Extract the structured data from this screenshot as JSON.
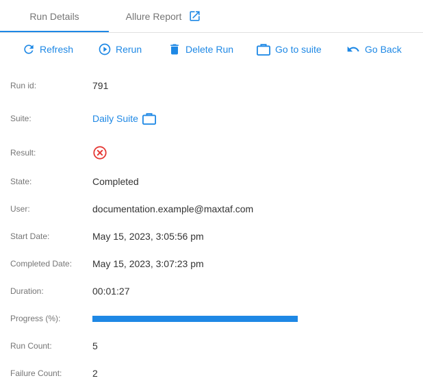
{
  "colors": {
    "accent": "#1e88e5",
    "error": "#e53935",
    "label": "#757575",
    "text": "#333333"
  },
  "tabs": [
    {
      "label": "Run Details",
      "active": true
    },
    {
      "label": "Allure Report",
      "icon": "open-in-new-icon"
    }
  ],
  "toolbar": {
    "refresh_label": "Refresh",
    "rerun_label": "Rerun",
    "delete_label": "Delete Run",
    "go_to_suite_label": "Go to suite",
    "go_back_label": "Go Back"
  },
  "details": {
    "run_id_label": "Run id:",
    "run_id": "791",
    "suite_label": "Suite:",
    "suite": "Daily Suite",
    "result_label": "Result:",
    "result_icon": "failed-circle-x-icon",
    "state_label": "State:",
    "state": "Completed",
    "user_label": "User:",
    "user": "documentation.example@maxtaf.com",
    "start_date_label": "Start Date:",
    "start_date": "May 15, 2023, 3:05:56 pm",
    "completed_date_label": "Completed Date:",
    "completed_date": "May 15, 2023, 3:07:23 pm",
    "duration_label": "Duration:",
    "duration": "00:01:27",
    "progress_label": "Progress (%):",
    "progress_percent": 100,
    "run_count_label": "Run Count:",
    "run_count": "5",
    "failure_count_label": "Failure Count:",
    "failure_count": "2"
  }
}
